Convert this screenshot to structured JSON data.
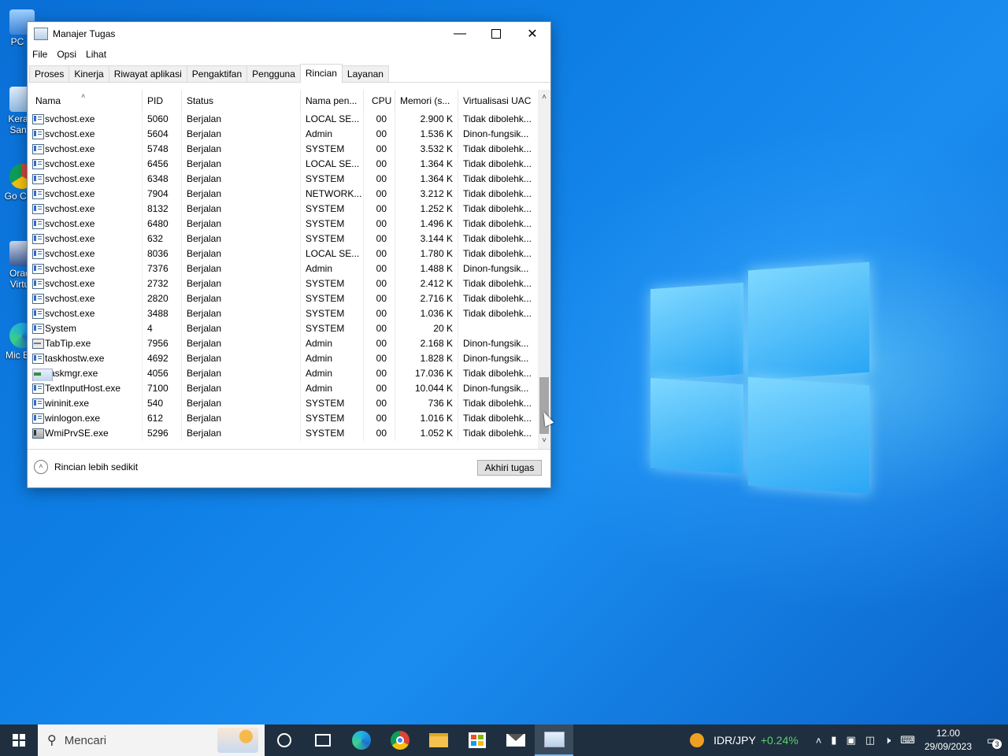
{
  "desktop": {
    "icons": [
      {
        "label": "PC"
      },
      {
        "label": "Kera San"
      },
      {
        "label": "Go Chr"
      },
      {
        "label": "Orac Virtu"
      },
      {
        "label": "Mic Ec"
      }
    ]
  },
  "window": {
    "title": "Manajer Tugas",
    "menu": [
      "File",
      "Opsi",
      "Lihat"
    ],
    "tabs": [
      "Proses",
      "Kinerja",
      "Riwayat aplikasi",
      "Pengaktifan",
      "Pengguna",
      "Rincian",
      "Layanan"
    ],
    "active_tab": "Rincian",
    "columns": [
      "Nama",
      "PID",
      "Status",
      "Nama pen...",
      "CPU",
      "Memori (s...",
      "Virtualisasi UAC"
    ],
    "rows": [
      {
        "name": "svchost.exe",
        "pid": "5060",
        "status": "Berjalan",
        "user": "LOCAL SE...",
        "cpu": "00",
        "mem": "2.900 K",
        "uac": "Tidak dibolehk..."
      },
      {
        "name": "svchost.exe",
        "pid": "5604",
        "status": "Berjalan",
        "user": "Admin",
        "cpu": "00",
        "mem": "1.536 K",
        "uac": "Dinon-fungsik..."
      },
      {
        "name": "svchost.exe",
        "pid": "5748",
        "status": "Berjalan",
        "user": "SYSTEM",
        "cpu": "00",
        "mem": "3.532 K",
        "uac": "Tidak dibolehk..."
      },
      {
        "name": "svchost.exe",
        "pid": "6456",
        "status": "Berjalan",
        "user": "LOCAL SE...",
        "cpu": "00",
        "mem": "1.364 K",
        "uac": "Tidak dibolehk..."
      },
      {
        "name": "svchost.exe",
        "pid": "6348",
        "status": "Berjalan",
        "user": "SYSTEM",
        "cpu": "00",
        "mem": "1.364 K",
        "uac": "Tidak dibolehk..."
      },
      {
        "name": "svchost.exe",
        "pid": "7904",
        "status": "Berjalan",
        "user": "NETWORK...",
        "cpu": "00",
        "mem": "3.212 K",
        "uac": "Tidak dibolehk..."
      },
      {
        "name": "svchost.exe",
        "pid": "8132",
        "status": "Berjalan",
        "user": "SYSTEM",
        "cpu": "00",
        "mem": "1.252 K",
        "uac": "Tidak dibolehk..."
      },
      {
        "name": "svchost.exe",
        "pid": "6480",
        "status": "Berjalan",
        "user": "SYSTEM",
        "cpu": "00",
        "mem": "1.496 K",
        "uac": "Tidak dibolehk..."
      },
      {
        "name": "svchost.exe",
        "pid": "632",
        "status": "Berjalan",
        "user": "SYSTEM",
        "cpu": "00",
        "mem": "3.144 K",
        "uac": "Tidak dibolehk..."
      },
      {
        "name": "svchost.exe",
        "pid": "8036",
        "status": "Berjalan",
        "user": "LOCAL SE...",
        "cpu": "00",
        "mem": "1.780 K",
        "uac": "Tidak dibolehk..."
      },
      {
        "name": "svchost.exe",
        "pid": "7376",
        "status": "Berjalan",
        "user": "Admin",
        "cpu": "00",
        "mem": "1.488 K",
        "uac": "Dinon-fungsik..."
      },
      {
        "name": "svchost.exe",
        "pid": "2732",
        "status": "Berjalan",
        "user": "SYSTEM",
        "cpu": "00",
        "mem": "2.412 K",
        "uac": "Tidak dibolehk..."
      },
      {
        "name": "svchost.exe",
        "pid": "2820",
        "status": "Berjalan",
        "user": "SYSTEM",
        "cpu": "00",
        "mem": "2.716 K",
        "uac": "Tidak dibolehk..."
      },
      {
        "name": "svchost.exe",
        "pid": "3488",
        "status": "Berjalan",
        "user": "SYSTEM",
        "cpu": "00",
        "mem": "1.036 K",
        "uac": "Tidak dibolehk..."
      },
      {
        "name": "System",
        "pid": "4",
        "status": "Berjalan",
        "user": "SYSTEM",
        "cpu": "00",
        "mem": "20 K",
        "uac": ""
      },
      {
        "name": "TabTip.exe",
        "pid": "7956",
        "status": "Berjalan",
        "user": "Admin",
        "cpu": "00",
        "mem": "2.168 K",
        "uac": "Dinon-fungsik..."
      },
      {
        "name": "taskhostw.exe",
        "pid": "4692",
        "status": "Berjalan",
        "user": "Admin",
        "cpu": "00",
        "mem": "1.828 K",
        "uac": "Dinon-fungsik..."
      },
      {
        "name": "Taskmgr.exe",
        "pid": "4056",
        "status": "Berjalan",
        "user": "Admin",
        "cpu": "00",
        "mem": "17.036 K",
        "uac": "Tidak dibolehk..."
      },
      {
        "name": "TextInputHost.exe",
        "pid": "7100",
        "status": "Berjalan",
        "user": "Admin",
        "cpu": "00",
        "mem": "10.044 K",
        "uac": "Dinon-fungsik..."
      },
      {
        "name": "wininit.exe",
        "pid": "540",
        "status": "Berjalan",
        "user": "SYSTEM",
        "cpu": "00",
        "mem": "736 K",
        "uac": "Tidak dibolehk..."
      },
      {
        "name": "winlogon.exe",
        "pid": "612",
        "status": "Berjalan",
        "user": "SYSTEM",
        "cpu": "00",
        "mem": "1.016 K",
        "uac": "Tidak dibolehk..."
      },
      {
        "name": "WmiPrvSE.exe",
        "pid": "5296",
        "status": "Berjalan",
        "user": "SYSTEM",
        "cpu": "00",
        "mem": "1.052 K",
        "uac": "Tidak dibolehk..."
      }
    ],
    "fewer_details": "Rincian lebih sedikit",
    "end_task": "Akhiri tugas"
  },
  "taskbar": {
    "search_placeholder": "Mencari",
    "ticker_pair": "IDR/JPY",
    "ticker_change": "+0.24%",
    "time": "12.00",
    "date": "29/09/2023",
    "notification_count": "3"
  }
}
